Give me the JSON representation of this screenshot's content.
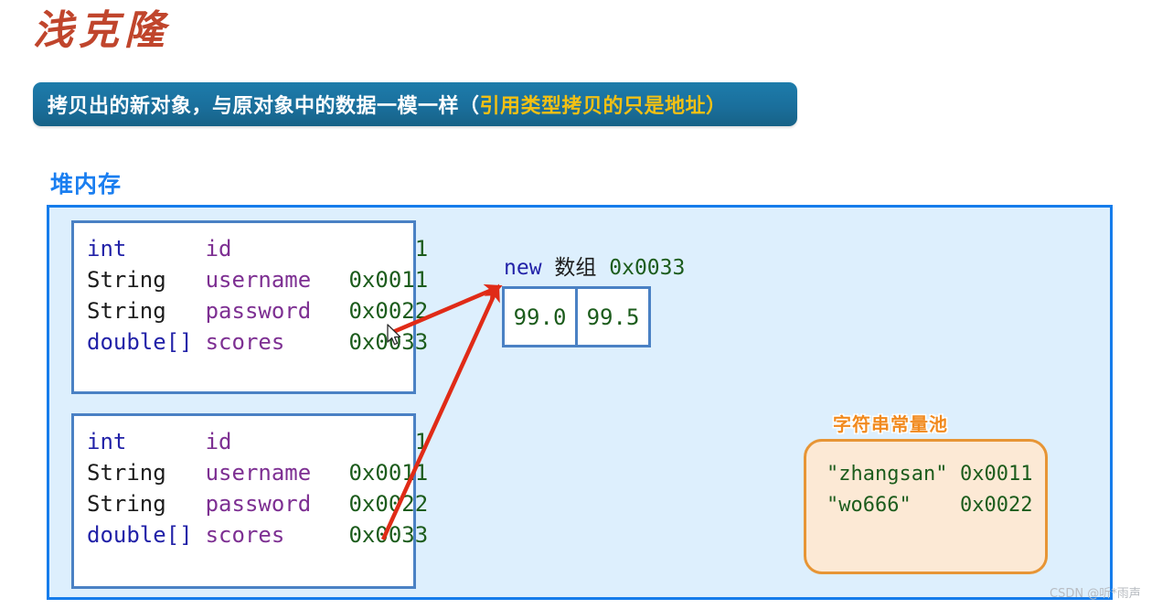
{
  "slide": {
    "title": "浅克隆",
    "title_color": "#c0452c",
    "banner": {
      "text_main": "拷贝出的新对象，与原对象中的数据一模一样（",
      "text_highlight": "引用类型拷贝的只是地址",
      "text_tail": "）",
      "bg_color": "#1a6f9c",
      "text_color": "#ffffff",
      "highlight_color": "#f2c014"
    },
    "watermark": "CSDN @听*雨声"
  },
  "heap": {
    "heading": "堆内存",
    "heading_color": "#1a7ef0",
    "border_color": "#157ceb",
    "fill_color": "#ddeffd",
    "objects": [
      {
        "name": "original-object",
        "fields": [
          {
            "type": "int",
            "type_style": "keyword",
            "field": "id",
            "value": "1"
          },
          {
            "type": "String",
            "type_style": "plain",
            "field": "username",
            "value": "0x0011"
          },
          {
            "type": "String",
            "type_style": "plain",
            "field": "password",
            "value": "0x0022"
          },
          {
            "type": "double[]",
            "type_style": "keyword",
            "field": "scores",
            "value": "0x0033"
          }
        ]
      },
      {
        "name": "cloned-object",
        "fields": [
          {
            "type": "int",
            "type_style": "keyword",
            "field": "id",
            "value": "1"
          },
          {
            "type": "String",
            "type_style": "plain",
            "field": "username",
            "value": "0x0011"
          },
          {
            "type": "String",
            "type_style": "plain",
            "field": "password",
            "value": "0x0022"
          },
          {
            "type": "double[]",
            "type_style": "keyword",
            "field": "scores",
            "value": "0x0033"
          }
        ]
      }
    ],
    "array": {
      "caption_new": "new",
      "caption_cn": "数组",
      "caption_addr": "0x0033",
      "cells": [
        "99.0",
        "99.5"
      ],
      "border_color": "#4a81c4"
    },
    "string_pool": {
      "title": "字符串常量池",
      "title_color": "#f18a1e",
      "border_color": "#e79535",
      "fill_color": "#fce9d5",
      "entries": [
        {
          "literal": "\"zhangsan\"",
          "address": "0x0011"
        },
        {
          "literal": "\"wo666\"",
          "address": "0x0022"
        }
      ]
    },
    "arrows": {
      "color": "#e02b17",
      "count": 2,
      "from_labels": [
        "original-object.scores",
        "cloned-object.scores"
      ],
      "to_label": "array-box"
    }
  }
}
